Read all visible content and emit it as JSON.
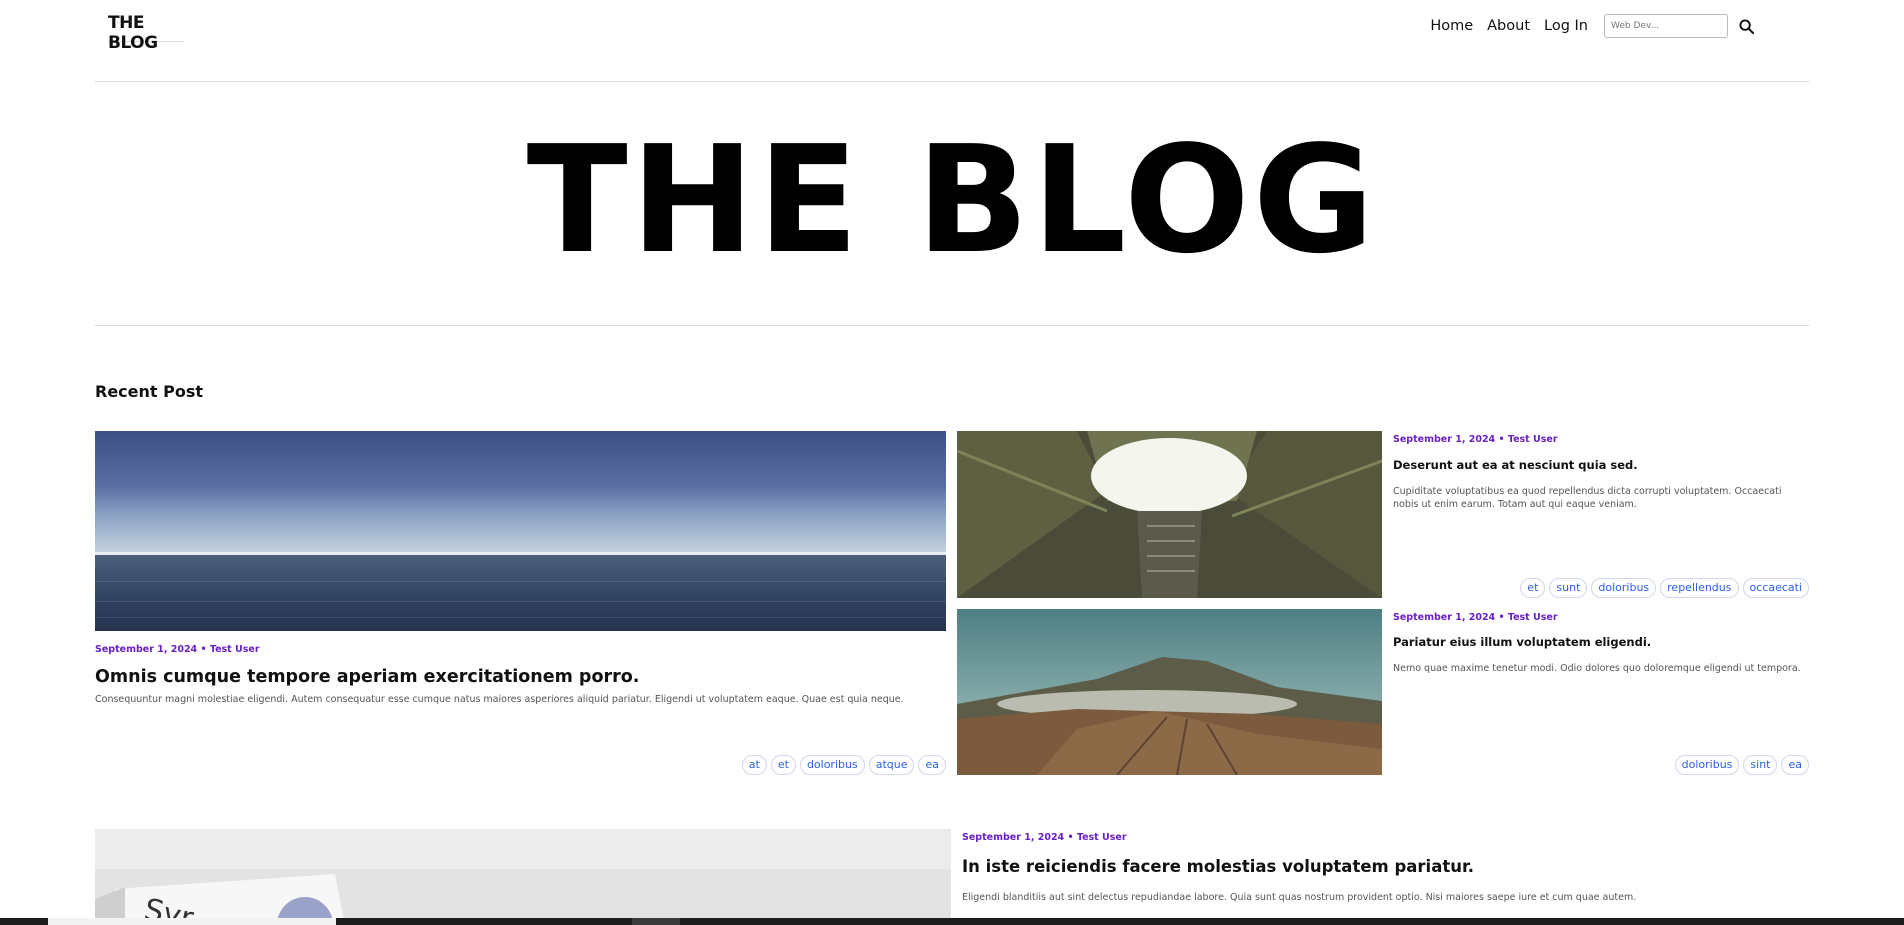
{
  "header": {
    "logo": "THE BLOG",
    "nav": [
      "Home",
      "About",
      "Log In"
    ],
    "search_placeholder": "Web Dev..."
  },
  "hero": {
    "title": "THE BLOG"
  },
  "recent": {
    "heading": "Recent Post",
    "featured": {
      "meta": "September 1, 2024 • Test User",
      "title": "Omnis cumque tempore aperiam exercitationem porro.",
      "excerpt": "Consequuntur magni molestiae eligendi. Autem consequatur esse cumque natus maiores asperiores aliquid pariatur. Eligendi ut voluptatem eaque. Quae est quia neque.",
      "tags": [
        "at",
        "et",
        "doloribus",
        "atque",
        "ea"
      ]
    },
    "side_posts": [
      {
        "meta": "September 1, 2024 • Test User",
        "title": "Deserunt aut ea at nesciunt quia sed.",
        "excerpt": "Cupiditate voluptatibus ea quod repellendus dicta corrupti voluptatem. Occaecati nobis ut enim earum. Totam aut qui eaque veniam.",
        "tags": [
          "et",
          "sunt",
          "doloribus",
          "repellendus",
          "occaecati"
        ]
      },
      {
        "meta": "September 1, 2024 • Test User",
        "title": "Pariatur eius illum voluptatem eligendi.",
        "excerpt": "Nemo quae maxime tenetur modi. Odio dolores quo doloremque eligendi ut tempora.",
        "tags": [
          "doloribus",
          "sint",
          "ea"
        ]
      }
    ],
    "wide_post": {
      "meta": "September 1, 2024 • Test User",
      "title": "In iste reiciendis facere molestias voluptatem pariatur.",
      "excerpt": "Eligendi blanditiis aut sint delectus repudiandae labore. Quia sunt quas nostrum provident optio. Nisi maiores saepe iure et cum quae autem."
    }
  },
  "colors": {
    "meta": "#6a1fc8",
    "tag": "#2c5fe6"
  }
}
